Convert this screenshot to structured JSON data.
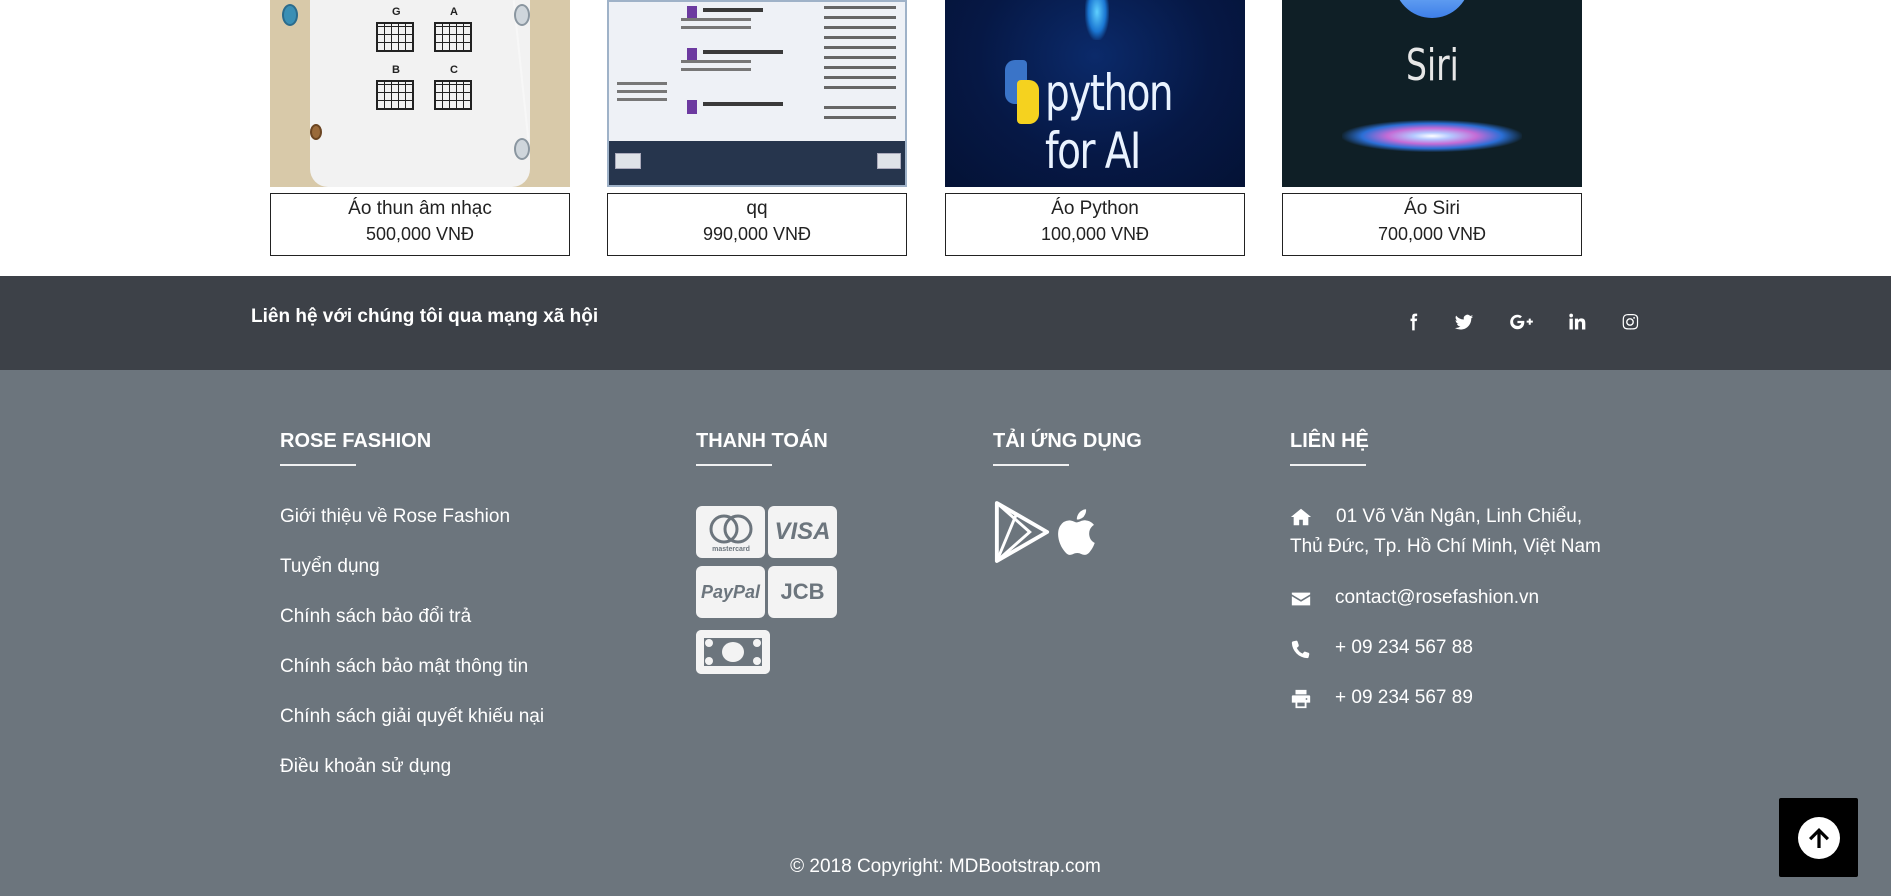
{
  "products": [
    {
      "name": "Áo thun âm nhạc",
      "price": "500,000 VNĐ"
    },
    {
      "name": "qq",
      "price": "990,000 VNĐ"
    },
    {
      "name": "Áo Python",
      "price": "100,000 VNĐ"
    },
    {
      "name": "Áo Siri",
      "price": "700,000 VNĐ"
    }
  ],
  "thumbs": {
    "chords": [
      "G",
      "A",
      "B",
      "C"
    ],
    "python_text": "python for AI",
    "siri_text": "Siri"
  },
  "social": {
    "text": "Liên hệ với chúng tôi qua mạng xã hội",
    "icons": [
      "facebook-icon",
      "twitter-icon",
      "google-plus-icon",
      "linkedin-icon",
      "instagram-icon"
    ]
  },
  "footer": {
    "brand": {
      "title": "ROSE FASHION",
      "links": [
        "Giới thiệu về Rose Fashion",
        "Tuyển dụng",
        "Chính sách bảo đổi trả",
        "Chính sách bảo mật thông tin",
        "Chính sách giải quyết khiếu nại",
        "Điều khoản sử dụng"
      ]
    },
    "payment": {
      "title": "THANH TOÁN",
      "methods": [
        "mastercard",
        "VISA",
        "PayPal",
        "JCB",
        "cash"
      ]
    },
    "apps": {
      "title": "TẢI ỨNG DỤNG",
      "icons": [
        "google-play-icon",
        "apple-icon"
      ]
    },
    "contact": {
      "title": "LIÊN HỆ",
      "address_line1": "01 Võ Văn Ngân, Linh Chiểu,",
      "address_line2": "Thủ Đức, Tp. Hồ Chí Minh, Việt Nam",
      "email": "contact@rosefashion.vn",
      "phone": "+ 09 234 567 88",
      "fax": "+ 09 234 567 89"
    },
    "copyright": "© 2018 Copyright: MDBootstrap.com"
  },
  "colors": {
    "social_bar": "#3d4148",
    "footer_bg": "#6c757d",
    "to_top_bg": "#000000"
  }
}
